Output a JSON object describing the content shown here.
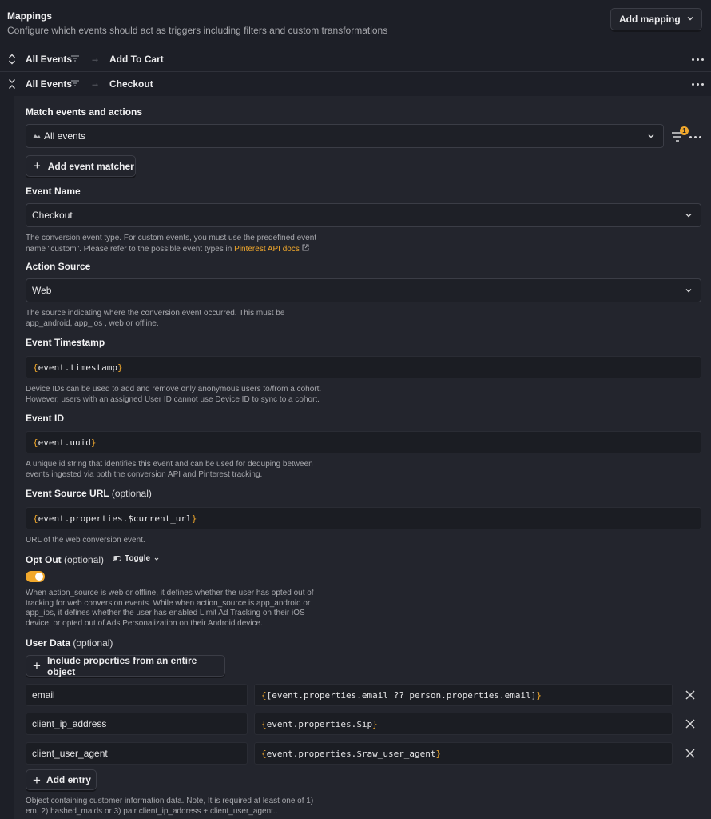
{
  "header": {
    "title": "Mappings",
    "subtitle": "Configure which events should act as triggers including filters and custom transformations",
    "add_mapping_label": "Add mapping"
  },
  "mappings": [
    {
      "source": "All Events",
      "arrow": "→",
      "target": "Add To Cart",
      "expanded": false
    },
    {
      "source": "All Events",
      "arrow": "→",
      "target": "Checkout",
      "expanded": true
    }
  ],
  "match": {
    "label": "Match events and actions",
    "selected": "All events",
    "filter_badge": "1",
    "add_matcher_label": "Add event matcher"
  },
  "event_name": {
    "label": "Event Name",
    "value": "Checkout",
    "help_line1": "The conversion event type. For custom events, you must use the predefined event",
    "help_line2_pre": "name \"custom\". Please refer to the possible event types in",
    "help_link": "Pinterest API docs"
  },
  "action_source": {
    "label": "Action Source",
    "value": "Web",
    "help_line1": "The source indicating where the conversion event occurred. This must be",
    "help_line2": "app_android, app_ios , web or offline."
  },
  "event_timestamp": {
    "label": "Event Timestamp",
    "open": "{",
    "inner": "event.timestamp",
    "close": "}",
    "help_line1": "Device IDs can be used to add and remove only anonymous users to/from a cohort.",
    "help_line2": "However, users with an assigned User ID cannot use Device ID to sync to a cohort."
  },
  "event_id": {
    "label": "Event ID",
    "open": "{",
    "inner": "event.uuid",
    "close": "}",
    "help_line1": "A unique id string that identifies this event and can be used for deduping between",
    "help_line2": "events ingested via both the conversion API and Pinterest tracking."
  },
  "event_source_url": {
    "label": "Event Source URL",
    "optional": "(optional)",
    "open": "{",
    "inner": "event.properties.$current_url",
    "close": "}",
    "help": "URL of the web conversion event."
  },
  "opt_out": {
    "label": "Opt Out",
    "optional": "(optional)",
    "mode_label": "Toggle",
    "value": true,
    "help_line1": "When action_source is web or offline, it defines whether the user has opted out of",
    "help_line2": "tracking for web conversion events. While when action_source is app_android or",
    "help_line3": "app_ios, it defines whether the user has enabled Limit Ad Tracking on their iOS",
    "help_line4": "device, or opted out of Ads Personalization on their Android device."
  },
  "user_data": {
    "label": "User Data",
    "optional": "(optional)",
    "include_label": "Include properties from an entire object",
    "entries": [
      {
        "key": "email",
        "open": "{",
        "inner": "[event.properties.email ?? person.properties.email]",
        "close": "}"
      },
      {
        "key": "client_ip_address",
        "open": "{",
        "inner": "event.properties.$ip",
        "close": "}"
      },
      {
        "key": "client_user_agent",
        "open": "{",
        "inner": "event.properties.$raw_user_agent",
        "close": "}"
      }
    ],
    "add_entry_label": "Add entry",
    "help_line1": "Object containing customer information data. Note, It is required at least one of 1)",
    "help_line2": "em, 2) hashed_maids or 3) pair client_ip_address + client_user_agent.."
  },
  "colors": {
    "accent": "#f1a82c",
    "background": "#1d1f27",
    "panel": "#23252d"
  }
}
